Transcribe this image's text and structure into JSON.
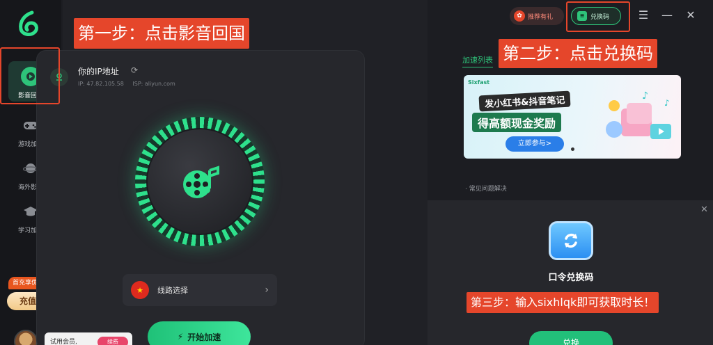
{
  "sidebar": {
    "logo": "app-logo",
    "items": [
      {
        "label": "影音回国",
        "icon": "video-play-icon",
        "active": true
      },
      {
        "label": "游戏加速",
        "icon": "gamepad-icon",
        "active": false
      },
      {
        "label": "海外影音",
        "icon": "planet-icon",
        "active": false
      },
      {
        "label": "学习加速",
        "icon": "graduation-cap-icon",
        "active": false
      }
    ],
    "promo_badge": "首充享优惠",
    "recharge_label": "充值"
  },
  "topbar": {
    "gift_label": "推荐有礼",
    "redeem_label": "兑换码"
  },
  "main": {
    "ip_title": "你的IP地址",
    "ip_label": "IP: 47.82.105.58",
    "isp_label": "ISP: aliyun.com",
    "route_label": "线路选择",
    "start_label": "开始加速",
    "trial_text": "试用会员,",
    "trial_pill": "续费"
  },
  "right": {
    "list_title": "加速列表",
    "banner": {
      "brand": "Sixfast",
      "headline": "发小红书&抖音笔记",
      "subline": "得高额现金奖励",
      "join_label": "立即参与>"
    },
    "faq_label": "· 常见问题解决",
    "redeem_title": "口令兑换码",
    "redeem_button": "兑换"
  },
  "annotations": {
    "step1": "第一步：点击影音回国",
    "step2": "第二步：点击兑换码",
    "step3": "第三步：输入sixhlqk即可获取时长！"
  },
  "colors": {
    "accent": "#2ec47a",
    "annotation": "#e5462b",
    "background": "#1c1d22"
  }
}
